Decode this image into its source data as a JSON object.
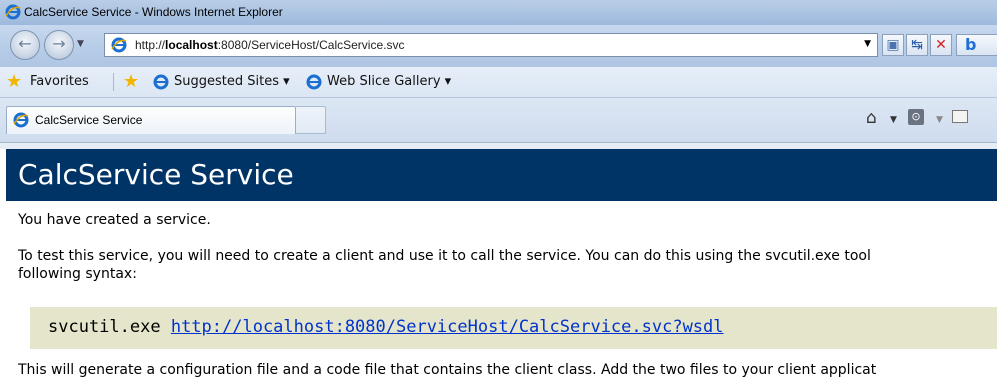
{
  "window": {
    "title": "CalcService Service - Windows Internet Explorer"
  },
  "address_bar": {
    "url_prefix": "http://",
    "url_host": "localhost",
    "url_rest": ":8080/ServiceHost/CalcService.svc"
  },
  "favorites_bar": {
    "favorites_label": "Favorites",
    "suggested_sites_label": "Suggested Sites ▾",
    "web_slice_label": "Web Slice Gallery ▾"
  },
  "tab": {
    "label": "CalcService Service"
  },
  "page": {
    "heading": "CalcService Service",
    "para1": "You have created a service.",
    "para2_line1": "To test this service, you will need to create a client and use it to call the service. You can do this using the svcutil.exe tool",
    "para2_line2": "following syntax:",
    "code_command": "svcutil.exe ",
    "code_link": "http://localhost:8080/ServiceHost/CalcService.svc?wsdl",
    "para3": "This will generate a configuration file and a code file that contains the client class. Add the two files to your client applicat"
  },
  "colors": {
    "header_bg": "#003366",
    "code_bg": "#e5e5cc",
    "link": "#0033cc"
  }
}
